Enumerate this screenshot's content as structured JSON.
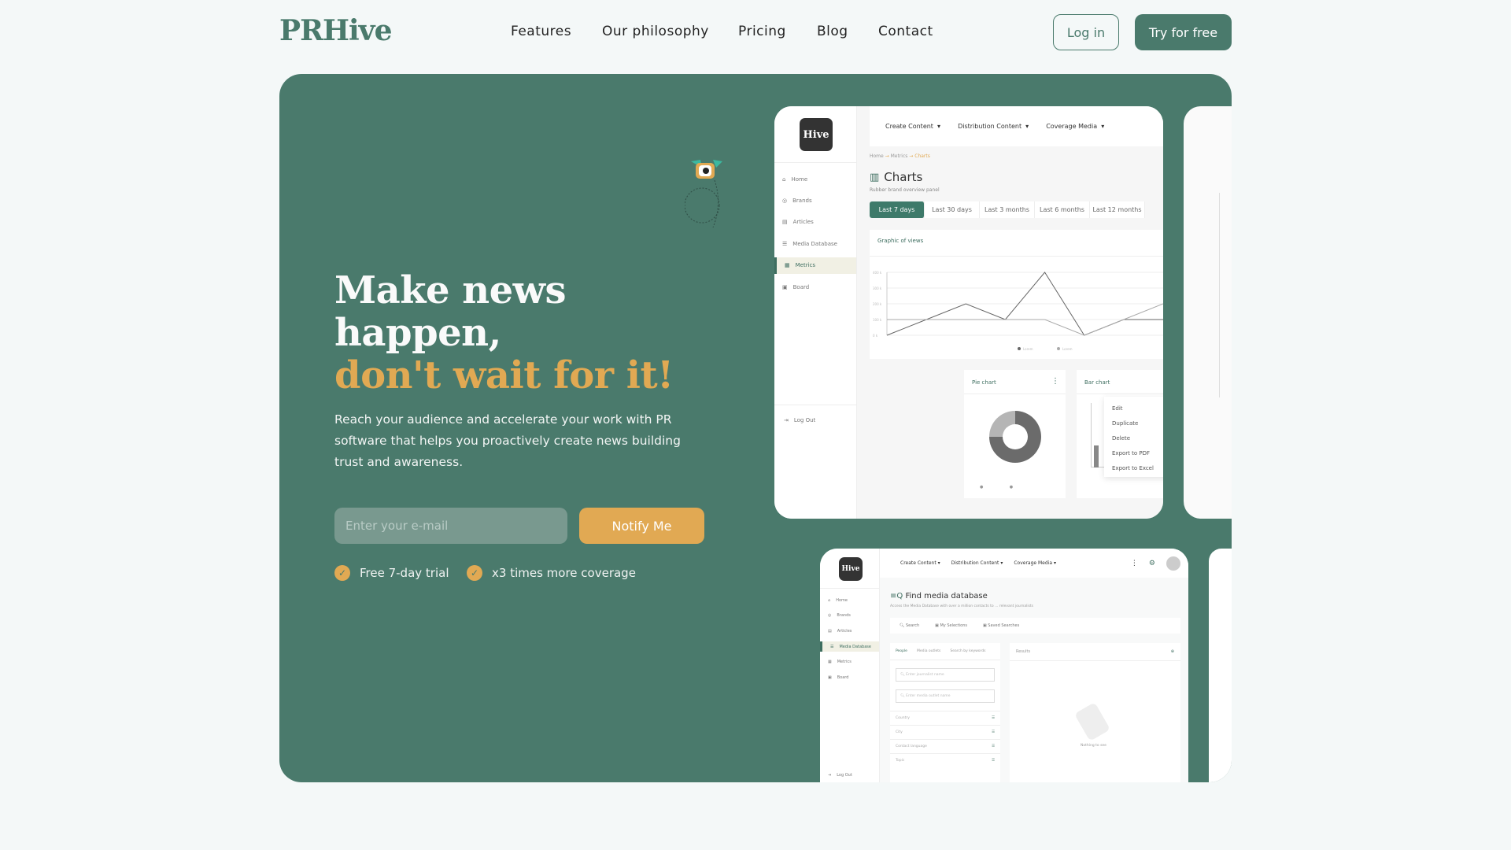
{
  "header": {
    "logo": "PRHive",
    "nav": [
      "Features",
      "Our philosophy",
      "Pricing",
      "Blog",
      "Contact"
    ],
    "login": "Log in",
    "try": "Try for free"
  },
  "hero": {
    "title_line1": "Make news",
    "title_line2": "happen,",
    "title_accent": "don't wait for it!",
    "lead": "Reach your audience and accelerate your work with PR software that helps you proactively create news building trust and awareness.",
    "email_placeholder": "Enter your e-mail",
    "notify": "Notify Me",
    "checks": [
      "Free 7-day trial",
      "x3 times more coverage"
    ],
    "colors": {
      "brand": "#4a7a6c",
      "accent": "#e1a953"
    }
  },
  "charts_mockup": {
    "logo": "Hive",
    "topnav": [
      "Create Content",
      "Distribution Content",
      "Coverage Media"
    ],
    "sidebar": [
      "Home",
      "Brands",
      "Articles",
      "Media Database",
      "Metrics",
      "Board"
    ],
    "active": "Metrics",
    "logout": "Log Out",
    "breadcrumb": [
      "Home",
      "Metrics",
      "Charts"
    ],
    "title": "Charts",
    "subtitle": "Rubber brand overview panel",
    "tabs": [
      "Last 7 days",
      "Last 30 days",
      "Last 3 months",
      "Last 6 months",
      "Last 12 months"
    ],
    "graph_title": "Graphic of views",
    "y_ticks": [
      "400 k",
      "300 k",
      "200 k",
      "100 k",
      "0 k"
    ],
    "series": [
      {
        "name": "Lorem",
        "color": "#666666",
        "values": [
          0,
          100,
          200,
          100,
          400,
          0,
          100,
          100
        ]
      },
      {
        "name": "Lorem",
        "color": "#aaaaaa",
        "values": [
          100,
          100,
          100,
          100,
          100,
          0,
          100,
          200
        ]
      }
    ],
    "pie_title": "Pie chart",
    "pie": {
      "values": [
        75,
        25
      ],
      "colors": [
        "#6b6b6b",
        "#b5b5b5"
      ]
    },
    "bar_title": "Bar chart",
    "menu": [
      "Edit",
      "Duplicate",
      "Delete",
      "Export to PDF",
      "Export to Excel"
    ]
  },
  "media_mockup": {
    "logo": "Hive",
    "topnav": [
      "Create Content",
      "Distribution Content",
      "Coverage Media"
    ],
    "sidebar": [
      "Home",
      "Brands",
      "Articles",
      "Media Database",
      "Metrics",
      "Board"
    ],
    "active": "Media Database",
    "logout": "Log Out",
    "title": "Find media database",
    "subtitle": "Access the Media Database with over a million contacts to ... relevant journalists",
    "tabs": [
      "Search",
      "My Selections",
      "Saved Searches"
    ],
    "subtabs": [
      "People",
      "Media outlets",
      "Search by keywords"
    ],
    "results": "Results",
    "inputs": [
      "Enter journalist name",
      "Enter media outlet name"
    ],
    "filters": [
      "Country",
      "City",
      "Contact language",
      "Topic"
    ],
    "empty": "Nothing to see"
  }
}
